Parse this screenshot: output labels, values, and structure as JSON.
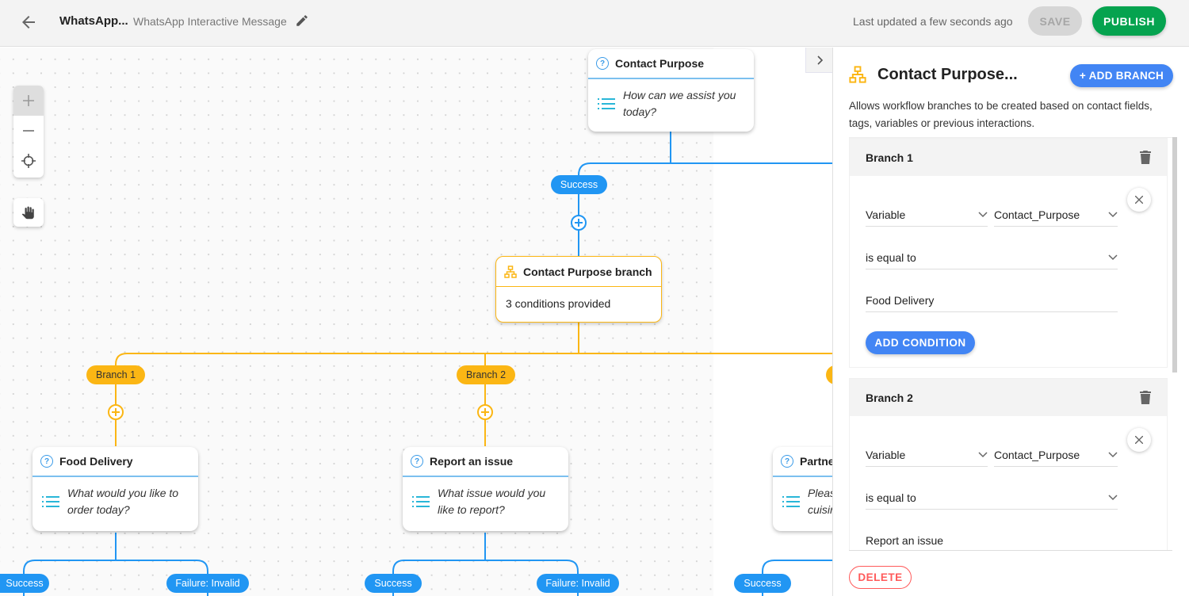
{
  "header": {
    "back_icon": "arrow-left-icon",
    "title": "WhatsApp...",
    "subtitle": "WhatsApp Interactive Message",
    "edit_icon": "pencil-icon",
    "last_updated": "Last updated a few seconds ago",
    "save_label": "SAVE",
    "publish_label": "PUBLISH"
  },
  "colors": {
    "primary_blue": "#2196f3",
    "button_blue": "#4285f4",
    "branch_amber": "#fbb614",
    "publish_green": "#05a34f",
    "delete_red": "#ff5a5a"
  },
  "canvas": {
    "controls": [
      "zoom-in",
      "zoom-out",
      "recenter",
      "pan-hand"
    ],
    "nodes": {
      "contact_purpose": {
        "title": "Contact Purpose",
        "body": [
          "How can we assist you",
          "today?"
        ]
      },
      "branch": {
        "title": "Contact Purpose branch",
        "body": "3 conditions provided"
      },
      "food_delivery": {
        "title": "Food Delivery",
        "body": [
          "What would you like to",
          "order today?"
        ]
      },
      "report_issue": {
        "title": "Report an issue",
        "body": [
          "What issue would you",
          "like to report?"
        ]
      },
      "partner": {
        "title": "Partner",
        "body": [
          "Pleas",
          "cuisir"
        ]
      }
    },
    "pills": {
      "success": "Success",
      "branch1": "Branch 1",
      "branch2": "Branch 2",
      "failure_invalid": "Failure: Invalid"
    }
  },
  "panel": {
    "title": "Contact Purpose...",
    "add_branch_label": "+ ADD BRANCH",
    "description": "Allows workflow branches to be created based on contact fields, tags, variables or previous interactions.",
    "branches": [
      {
        "name": "Branch 1",
        "type": "Variable",
        "variable": "Contact_Purpose",
        "operator": "is equal to",
        "value": "Food Delivery",
        "add_condition_label": "ADD CONDITION"
      },
      {
        "name": "Branch 2",
        "type": "Variable",
        "variable": "Contact_Purpose",
        "operator": "is equal to",
        "value": "Report an issue"
      }
    ],
    "delete_label": "DELETE"
  }
}
